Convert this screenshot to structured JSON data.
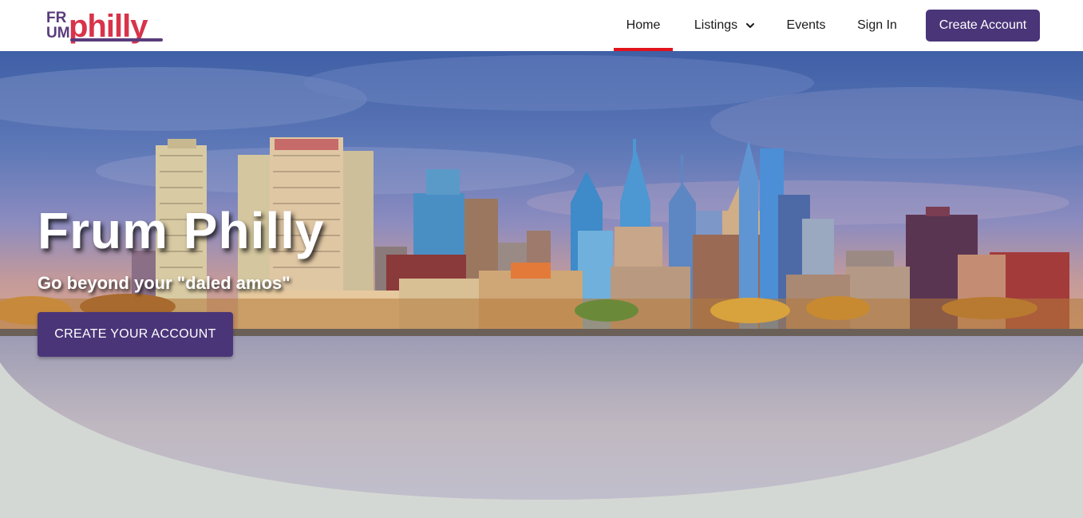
{
  "brand": {
    "logo_text_frum_top": "FR",
    "logo_text_frum_bottom": "UM",
    "logo_text_philly": "philly",
    "colors": {
      "logo_purple": "#5a3c7c",
      "logo_red": "#d8334a"
    }
  },
  "nav": {
    "items": [
      {
        "label": "Home",
        "active": true
      },
      {
        "label": "Listings",
        "has_dropdown": true,
        "icon": "chevron-down-icon"
      },
      {
        "label": "Events"
      },
      {
        "label": "Sign In"
      }
    ],
    "create_account_label": "Create Account",
    "active_indicator_color": "#e1141c"
  },
  "hero": {
    "title": "Frum Philly",
    "subtitle": "Go beyond your \"daled amos\"",
    "cta_label": "CREATE YOUR ACCOUNT",
    "image_subject": "Philadelphia skyline reflected in river",
    "colors": {
      "button": "#4a3579",
      "backdrop": "#d4d8d4"
    }
  }
}
